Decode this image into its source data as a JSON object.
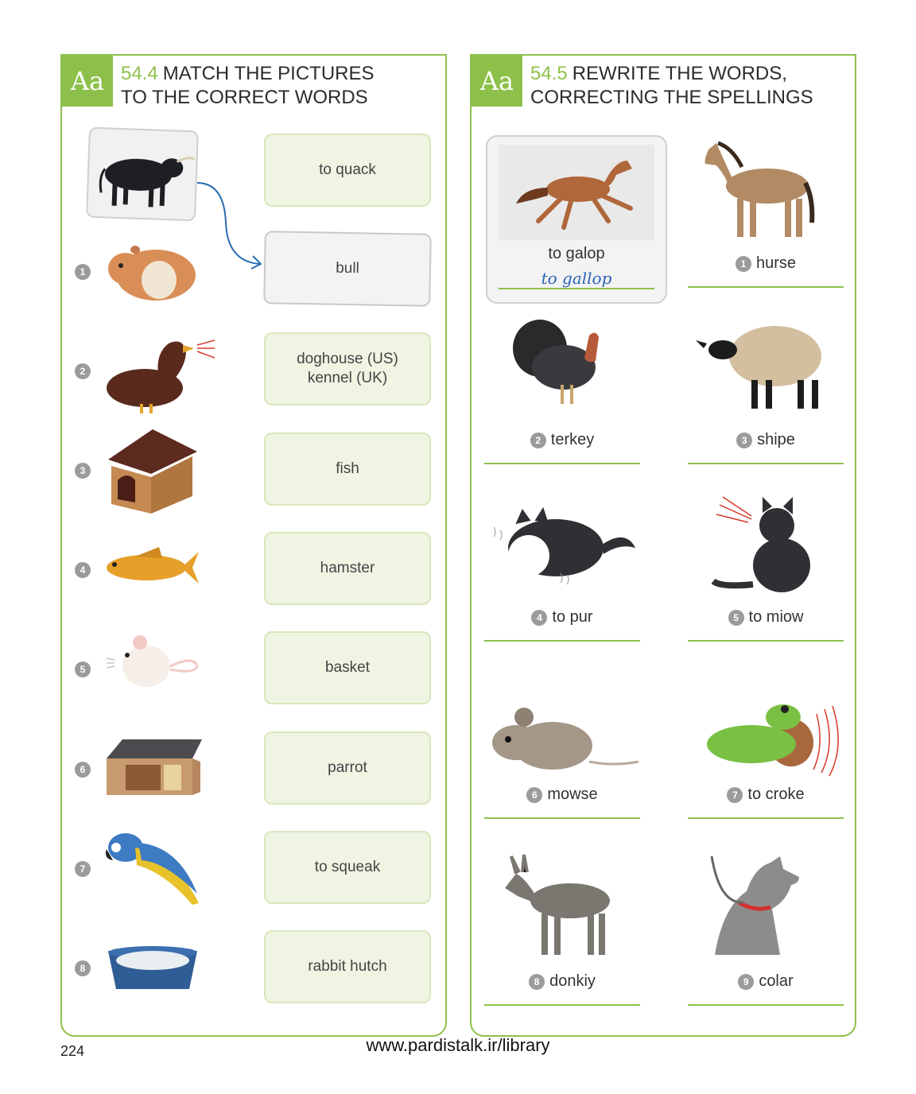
{
  "left": {
    "badge": "Aa",
    "number": "54.4",
    "title_line1": "MATCH THE PICTURES",
    "title_line2": "TO THE CORRECT WORDS",
    "words": [
      "to quack",
      "bull",
      "doghouse (US)\nkennel (UK)",
      "fish",
      "hamster",
      "basket",
      "parrot",
      "to squeak",
      "rabbit hutch"
    ],
    "numbers": [
      "1",
      "2",
      "3",
      "4",
      "5",
      "6",
      "7",
      "8"
    ],
    "pictures": [
      "bull-icon",
      "hamster-icon",
      "duck-quacking-icon",
      "kennel-icon",
      "fish-icon",
      "mouse-squeaking-icon",
      "rabbit-hutch-icon",
      "parrot-icon",
      "pet-basket-icon"
    ]
  },
  "right": {
    "badge": "Aa",
    "number": "54.5",
    "title_line1": "REWRITE THE WORDS,",
    "title_line2": "CORRECTING THE SPELLINGS",
    "example": {
      "word": "to galop",
      "answer": "to gallop",
      "picture": "galloping-horse-icon"
    },
    "items": [
      {
        "num": "1",
        "word": "hurse",
        "picture": "horse-icon"
      },
      {
        "num": "2",
        "word": "terkey",
        "picture": "turkey-icon"
      },
      {
        "num": "3",
        "word": "shipe",
        "picture": "sheep-icon"
      },
      {
        "num": "4",
        "word": "to pur",
        "picture": "purring-cat-icon"
      },
      {
        "num": "5",
        "word": "to miow",
        "picture": "meowing-cat-icon"
      },
      {
        "num": "6",
        "word": "mowse",
        "picture": "mouse-icon"
      },
      {
        "num": "7",
        "word": "to croke",
        "picture": "croaking-frog-icon"
      },
      {
        "num": "8",
        "word": "donkiy",
        "picture": "donkey-icon"
      },
      {
        "num": "9",
        "word": "colar",
        "picture": "dog-collar-icon"
      }
    ]
  },
  "page_number": "224",
  "footer_url": "www.pardistalk.ir/library",
  "colors": {
    "accent": "#8dc04a",
    "box_fill": "#eff4e3",
    "handwriting": "#2b63b5"
  }
}
